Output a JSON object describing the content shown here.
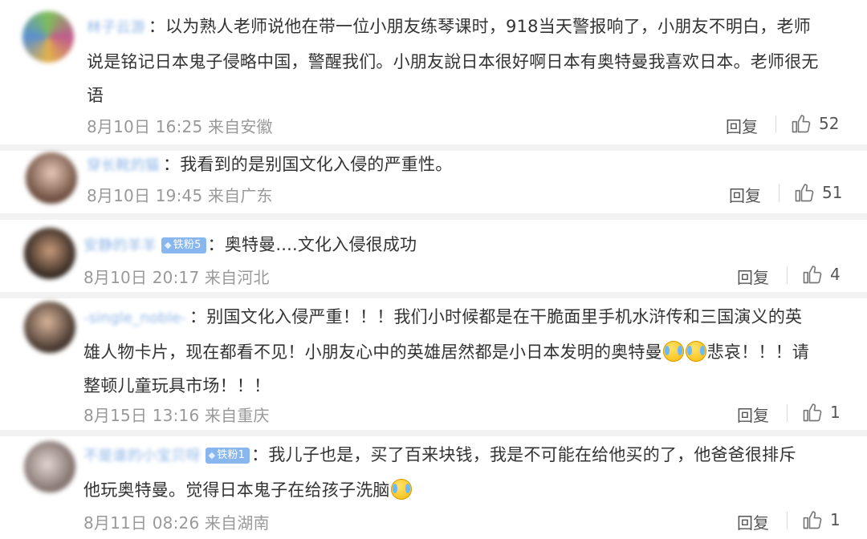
{
  "comments": [
    {
      "username": "林子云游",
      "content": "以为熟人老师说他在带一位小朋友练琴课时，918当天警报响了，小朋友不明白，老师说是铭记日本鬼子侵略中国，警醒我们。小朋友說日本很好啊日本有奥特曼我喜欢日本。老师很无语",
      "line1": "以为熟人老师说他在带一位小朋友练琴课时，918当天警报响了，小朋友不明白，老师",
      "line2": "说是铭记日本鬼子侵略中国，警醒我们。小朋友說日本很好啊日本有奥特曼我喜欢日本。老师很无",
      "line3": "语",
      "time": "8月10日 16:25 来自安徽",
      "reply_label": "回复",
      "likes": "52"
    },
    {
      "username": "穿长靴的猫",
      "content": "我看到的是别国文化入侵的严重性。",
      "time": "8月10日 19:45 来自广东",
      "reply_label": "回复",
      "likes": "51"
    },
    {
      "username": "安静的羊羊",
      "badge": "铁粉5",
      "content": "：奥特曼....文化入侵很成功",
      "time": "8月10日 20:17 来自河北",
      "reply_label": "回复",
      "likes": "4"
    },
    {
      "username": "-single_noble-",
      "line1": "别国文化入侵严重！！！我们小时候都是在干脆面里手机水浒传和三国演义的英",
      "line2a": "雄人物卡片，现在都看不见！小朋友心中的英雄居然都是小日本发明的奥特曼",
      "line2b": "悲哀！！！请",
      "line3": "整顿儿童玩具市场！！！",
      "time": "8月15日 13:16 来自重庆",
      "reply_label": "回复",
      "likes": "1"
    },
    {
      "username": "不是谁的小宝贝呀",
      "badge": "铁粉1",
      "line1": "：我儿子也是，买了百来块钱，我是不可能在给他买的了，他爸爸很排斥",
      "line2": "他玩奥特曼。觉得日本鬼子在给孩子洗脑",
      "time": "8月11日 08:26 来自湖南",
      "reply_label": "回复",
      "likes": "1"
    }
  ],
  "icons": {
    "like": "thumbs-up-icon",
    "emoji": "crying-laugh-emoji-icon",
    "badge": "diamond-icon"
  },
  "colors": {
    "username": "#8fb6e6",
    "badge": "#88b7f0",
    "meta": "#999999",
    "divider": "#f2f2f2"
  }
}
